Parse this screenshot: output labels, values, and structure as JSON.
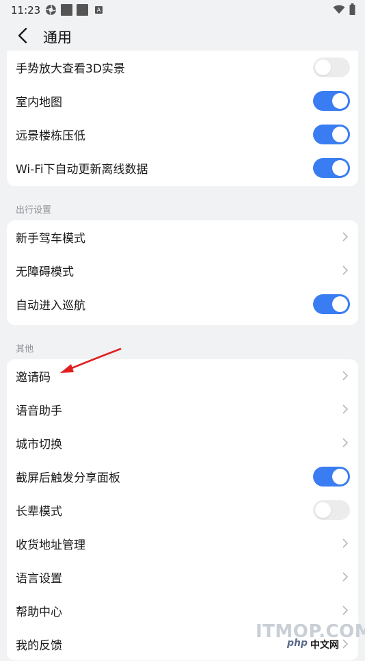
{
  "status_bar": {
    "time": "11:23",
    "a_icon_label": "A"
  },
  "header": {
    "title": "通用"
  },
  "card_top": {
    "items": [
      {
        "label": "手势放大查看3D实景",
        "control": "toggle",
        "on": false
      },
      {
        "label": "室内地图",
        "control": "toggle",
        "on": true
      },
      {
        "label": "远景楼栋压低",
        "control": "toggle",
        "on": true
      },
      {
        "label": "Wi-Fi下自动更新离线数据",
        "control": "toggle",
        "on": true
      }
    ]
  },
  "section_travel": {
    "title": "出行设置",
    "items": [
      {
        "label": "新手驾车模式",
        "control": "chevron"
      },
      {
        "label": "无障碍模式",
        "control": "chevron"
      },
      {
        "label": "自动进入巡航",
        "control": "toggle",
        "on": true
      }
    ]
  },
  "section_other": {
    "title": "其他",
    "items": [
      {
        "label": "邀请码",
        "control": "chevron"
      },
      {
        "label": "语音助手",
        "control": "chevron"
      },
      {
        "label": "城市切换",
        "control": "chevron"
      },
      {
        "label": "截屏后触发分享面板",
        "control": "toggle",
        "on": true
      },
      {
        "label": "长辈模式",
        "control": "toggle",
        "on": false
      },
      {
        "label": "收货地址管理",
        "control": "chevron"
      },
      {
        "label": "语言设置",
        "control": "chevron"
      },
      {
        "label": "帮助中心",
        "control": "chevron"
      },
      {
        "label": "我的反馈",
        "control": "chevron"
      }
    ]
  },
  "watermark": {
    "brand": "ITMOP.COM",
    "php": "php",
    "cn": "中文网"
  },
  "colors": {
    "accent": "#3a7df2",
    "background": "#f1f2f4",
    "annotation_arrow": "#e02020"
  }
}
